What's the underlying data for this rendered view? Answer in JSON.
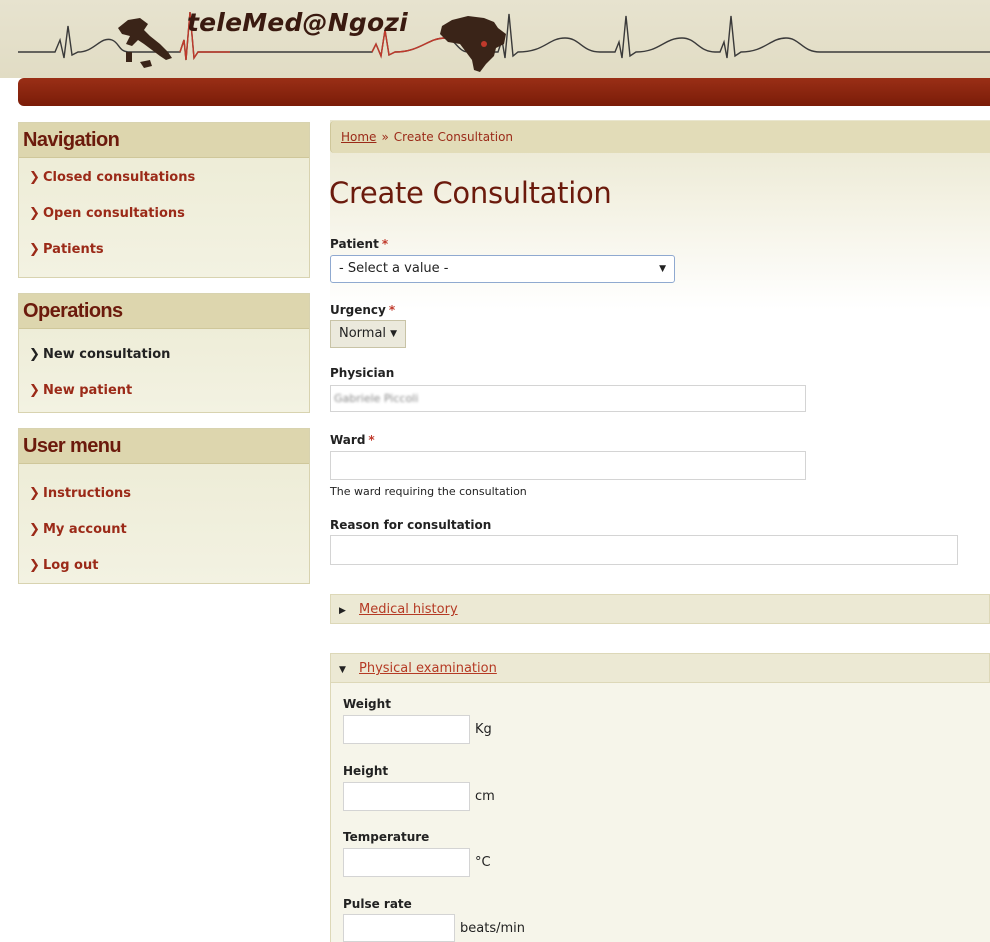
{
  "header": {
    "site_name": "teleMed@Ngozi"
  },
  "sidebar": {
    "navigation": {
      "title": "Navigation",
      "items": [
        {
          "label": "Closed consultations"
        },
        {
          "label": "Open consultations"
        },
        {
          "label": "Patients"
        }
      ]
    },
    "operations": {
      "title": "Operations",
      "items": [
        {
          "label": "New consultation"
        },
        {
          "label": "New patient"
        }
      ]
    },
    "user_menu": {
      "title": "User menu",
      "items": [
        {
          "label": "Instructions"
        },
        {
          "label": "My account"
        },
        {
          "label": "Log out"
        }
      ]
    }
  },
  "breadcrumb": {
    "home": "Home",
    "separator": "»",
    "current": "Create Consultation"
  },
  "page_title": "Create Consultation",
  "form": {
    "patient": {
      "label": "Patient",
      "value": "- Select a value -"
    },
    "urgency": {
      "label": "Urgency",
      "value": "Normal"
    },
    "physician": {
      "label": "Physician",
      "value": "Gabriele Piccoli"
    },
    "ward": {
      "label": "Ward",
      "value": "",
      "description": "The ward requiring the consultation"
    },
    "reason": {
      "label": "Reason for consultation",
      "value": ""
    },
    "required_marker": "*"
  },
  "medical_history": {
    "label": "Medical history",
    "collapsed": true
  },
  "physical_examination": {
    "label": "Physical examination",
    "collapsed": false,
    "fields": [
      {
        "label": "Weight",
        "value": "",
        "unit": "Kg"
      },
      {
        "label": "Height",
        "value": "",
        "unit": "cm"
      },
      {
        "label": "Temperature",
        "value": "",
        "unit": "°C"
      },
      {
        "label": "Pulse rate",
        "value": "",
        "unit": "beats/min"
      }
    ]
  },
  "icons": {
    "menu_item": "chevron-right-icon",
    "select_arrow": "dropdown-arrow-icon",
    "fieldset_collapsed": "triangle-right-icon",
    "fieldset_expanded": "triangle-down-icon"
  },
  "colors": {
    "brand_red": "#7a1c08",
    "title_red": "#6b1a0c",
    "link_red": "#9b2a18",
    "sidebar_bg": "#ecebd4",
    "required": "#c0392b"
  }
}
